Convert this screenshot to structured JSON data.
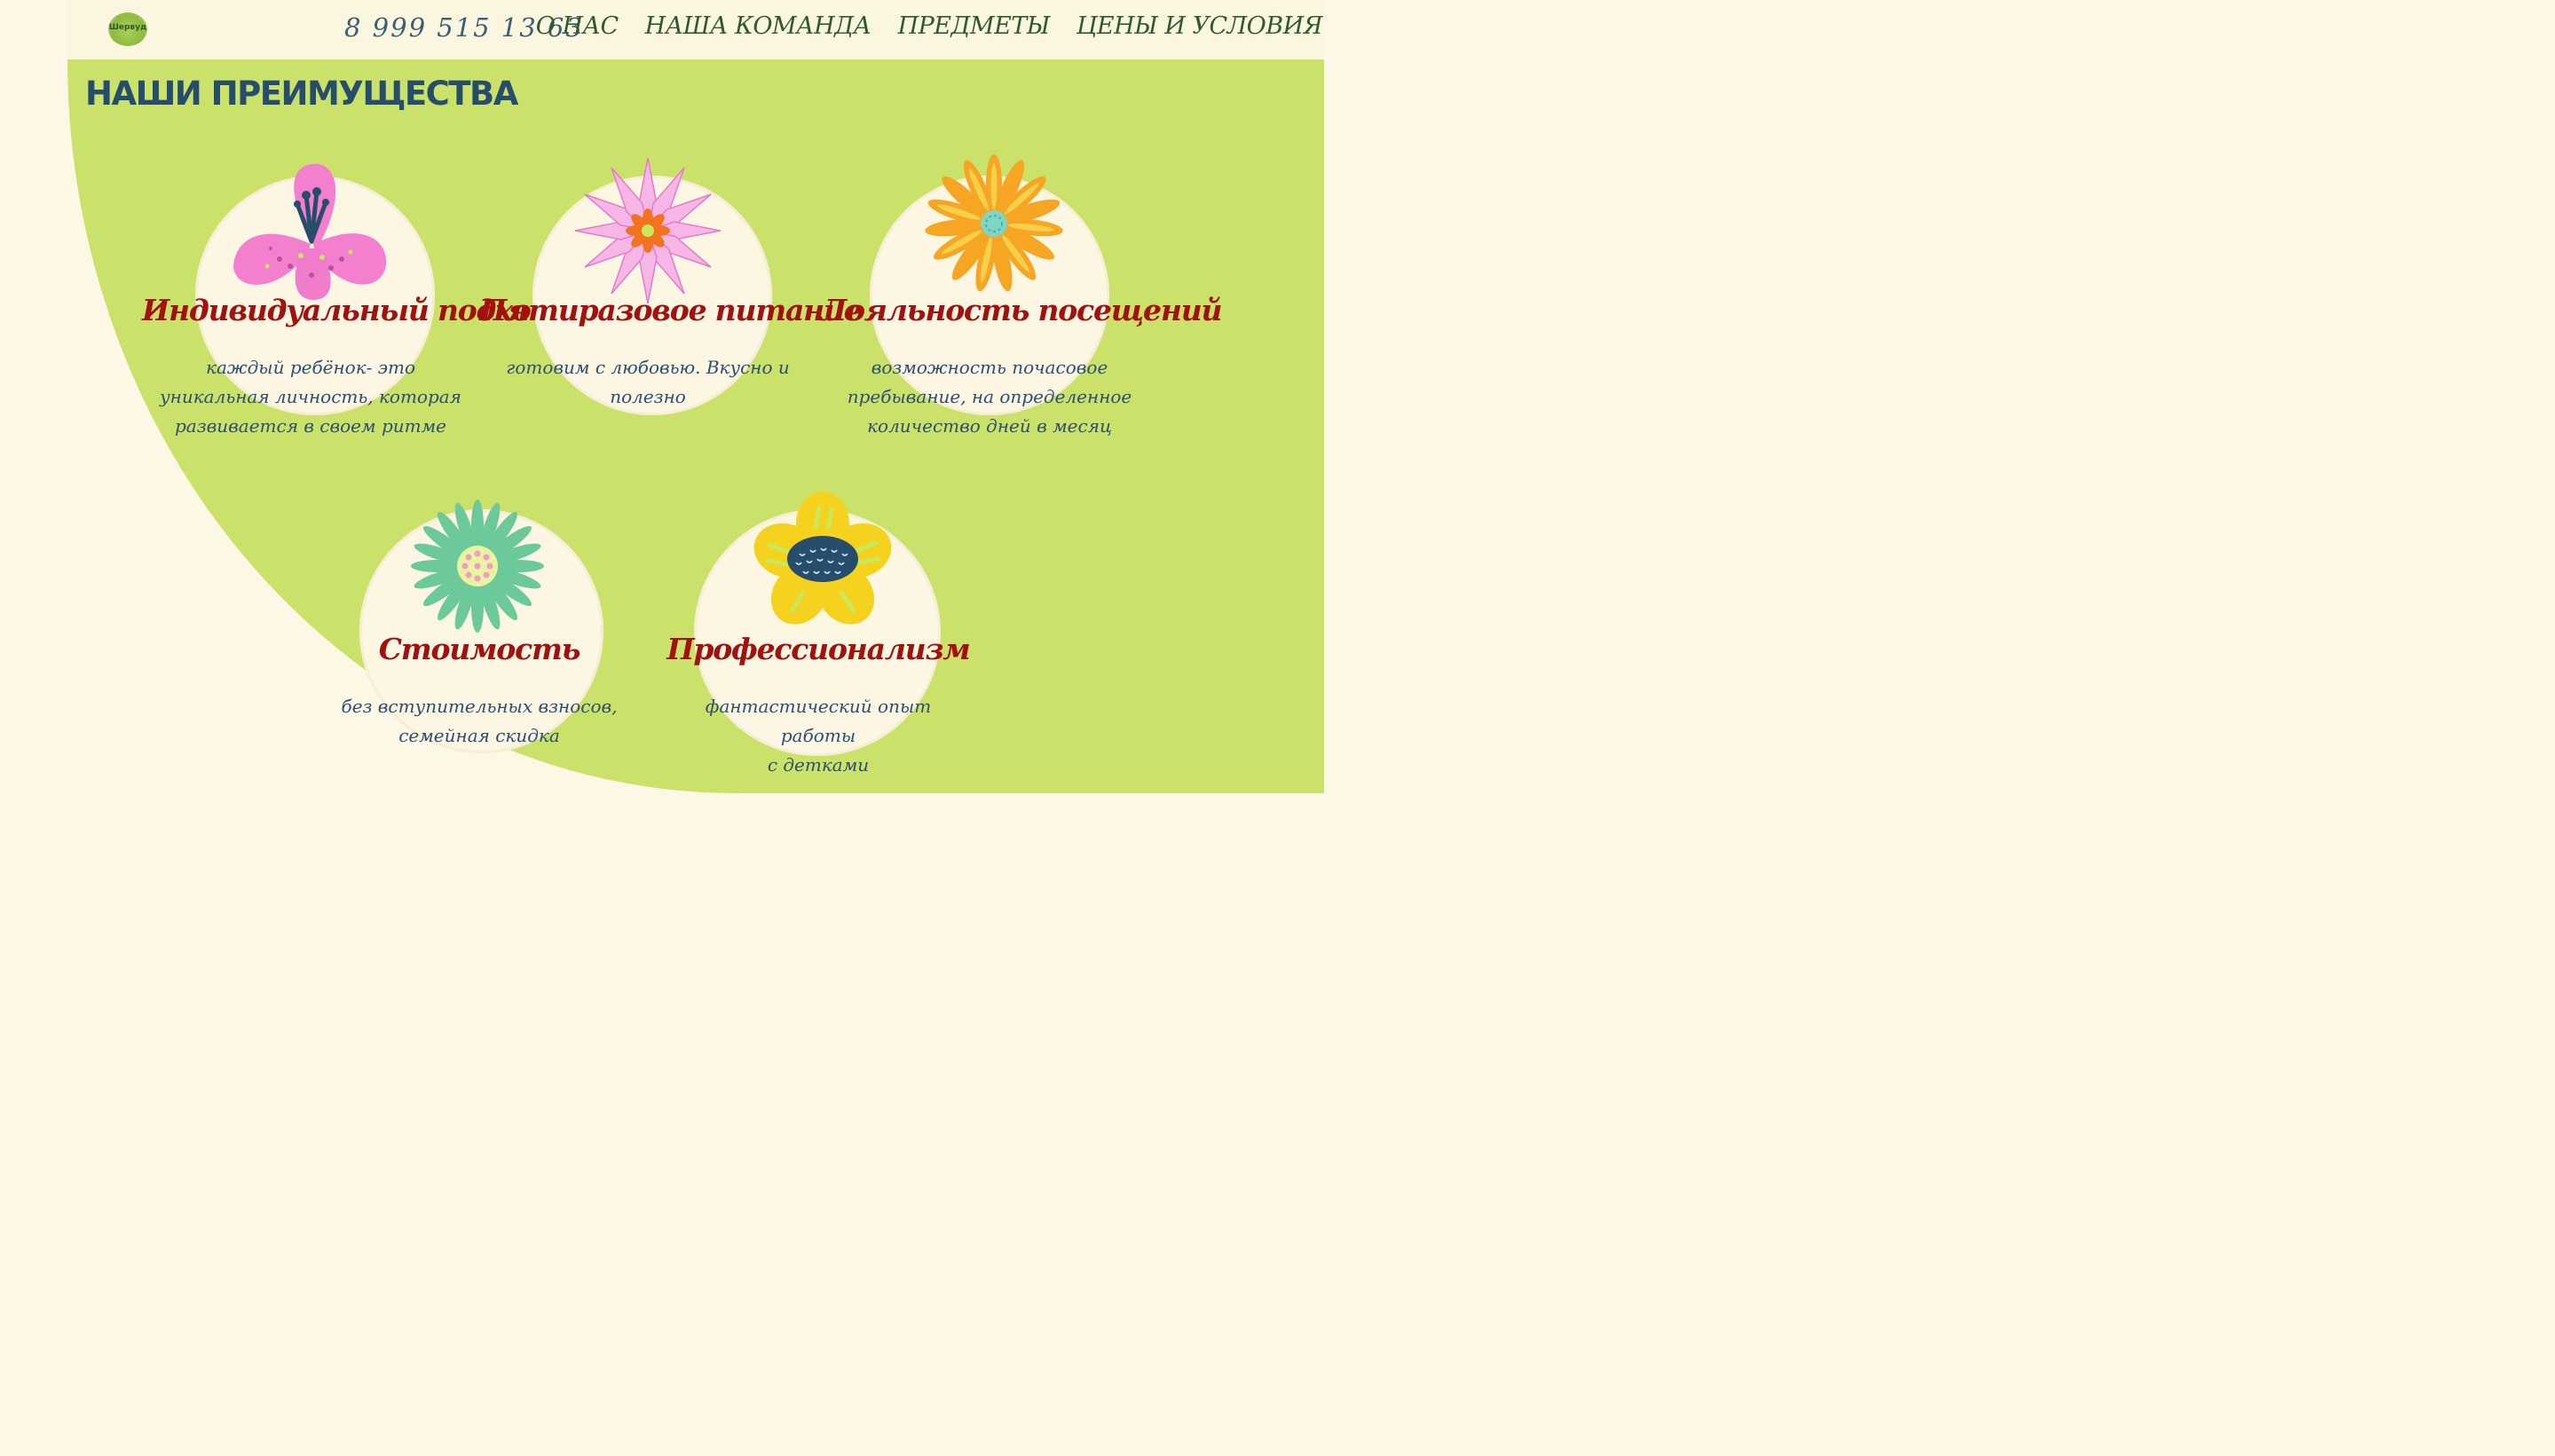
{
  "header": {
    "logo_text": "Шервуд",
    "phone": "8 999 515 13 63",
    "nav": [
      "О НАС",
      "НАША КОМАНДА",
      "ПРЕДМЕТЫ",
      "ЦЕНЫ И УСЛОВИЯ"
    ]
  },
  "section": {
    "title": "НАШИ ПРЕИМУЩЕСТВА"
  },
  "cards": [
    {
      "title": "Индивидуальный подход",
      "lines": [
        "каждый ребёнок- это",
        "уникальная личность, которая",
        "развивается в своем ритме"
      ],
      "icon": "pink-lily-flower"
    },
    {
      "title": "Пятиразовое питание",
      "lines": [
        "готовим с любовью. Вкусно и",
        "полезно"
      ],
      "icon": "pink-star-flower"
    },
    {
      "title": "Лояльность посещений",
      "lines": [
        "возможность почасовое",
        "пребывание, на определенное",
        "количество дней в месяц"
      ],
      "icon": "orange-daisy-flower"
    },
    {
      "title": "Стоимость",
      "lines": [
        "без вступительных взносов,",
        "семейная скидка"
      ],
      "icon": "green-aster-flower"
    },
    {
      "title": "Профессионализм",
      "lines": [
        "фантастический опыт работы",
        "с детками"
      ],
      "icon": "yellow-sunflower"
    }
  ],
  "colors": {
    "panel_green": "#cbe26a",
    "cream": "#fdf7e6",
    "title_red": "#a3110f",
    "text_blue": "#2c4f73",
    "heading_blue": "#264e6c",
    "nav_green": "#2f5a2e"
  }
}
